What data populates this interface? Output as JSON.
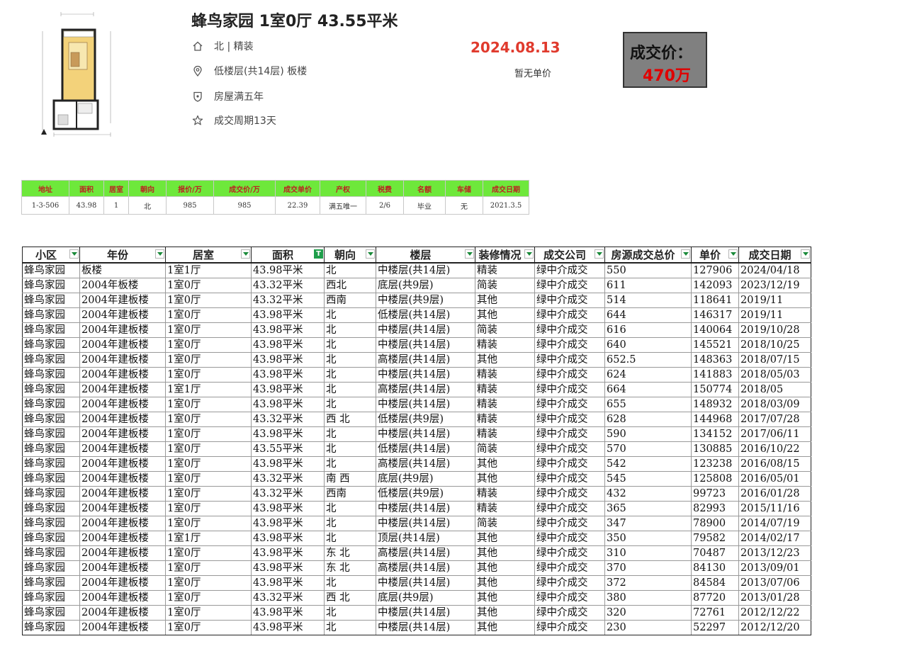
{
  "listing": {
    "title": "蜂鸟家园 1室0厅 43.55平米",
    "orientation_finish": "北 | 精装",
    "floor_building": "低楼层(共14层) 板楼",
    "ownership": "房屋满五年",
    "cycle": "成交周期13天",
    "deal_date": "2024.08.13",
    "unit_price_note": "暂无单价",
    "price_label": "成交价：",
    "price_value": "470万"
  },
  "icons": [
    "home-icon",
    "location-icon",
    "shield-icon",
    "star-icon"
  ],
  "colors": {
    "date_red": "#e03a2d",
    "price_red": "#e00000",
    "green_header": "#6ee83b",
    "filter_green": "#1e9e4a"
  },
  "summary_table": {
    "headers": [
      "地址",
      "面积",
      "居室",
      "朝向",
      "报价/万",
      "成交价/万",
      "成交单价",
      "产权",
      "税费",
      "名额",
      "车储",
      "成交日期"
    ],
    "row": [
      "1-3-506",
      "43.98",
      "1",
      "北",
      "985",
      "985",
      "22.39",
      "满五唯一",
      "2/6",
      "毕业",
      "无",
      "2021.3.5"
    ]
  },
  "deals_table": {
    "headers": [
      "小区",
      "年份",
      "居室",
      "面积",
      "朝向",
      "楼层",
      "装修情况",
      "成交公司",
      "房源成交总价",
      "单价",
      "成交日期"
    ],
    "filtered_column": "面积",
    "rows": [
      [
        "蜂鸟家园",
        "板楼",
        "1室1厅",
        "43.98平米",
        "北",
        "中楼层(共14层)",
        "精装",
        "绿中介成交",
        "550",
        "127906",
        "2024/04/18"
      ],
      [
        "蜂鸟家园",
        "2004年板楼",
        "1室0厅",
        "43.32平米",
        "西北",
        "底层(共9层)",
        "简装",
        "绿中介成交",
        "611",
        "142093",
        "2023/12/19"
      ],
      [
        "蜂鸟家园",
        "2004年建板楼",
        "1室0厅",
        "43.32平米",
        "西南",
        "中楼层(共9层)",
        "其他",
        "绿中介成交",
        "514",
        "118641",
        "2019/11"
      ],
      [
        "蜂鸟家园",
        "2004年建板楼",
        "1室0厅",
        "43.98平米",
        "北",
        "低楼层(共14层)",
        "其他",
        "绿中介成交",
        "644",
        "146317",
        "2019/11"
      ],
      [
        "蜂鸟家园",
        "2004年建板楼",
        "1室0厅",
        "43.98平米",
        "北",
        "中楼层(共14层)",
        "简装",
        "绿中介成交",
        "616",
        "140064",
        "2019/10/28"
      ],
      [
        "蜂鸟家园",
        "2004年建板楼",
        "1室0厅",
        "43.98平米",
        "北",
        "中楼层(共14层)",
        "精装",
        "绿中介成交",
        "640",
        "145521",
        "2018/10/25"
      ],
      [
        "蜂鸟家园",
        "2004年建板楼",
        "1室0厅",
        "43.98平米",
        "北",
        "高楼层(共14层)",
        "其他",
        "绿中介成交",
        "652.5",
        "148363",
        "2018/07/15"
      ],
      [
        "蜂鸟家园",
        "2004年建板楼",
        "1室0厅",
        "43.98平米",
        "北",
        "中楼层(共14层)",
        "精装",
        "绿中介成交",
        "624",
        "141883",
        "2018/05/03"
      ],
      [
        "蜂鸟家园",
        "2004年建板楼",
        "1室1厅",
        "43.98平米",
        "北",
        "高楼层(共14层)",
        "精装",
        "绿中介成交",
        "664",
        "150774",
        "2018/05"
      ],
      [
        "蜂鸟家园",
        "2004年建板楼",
        "1室0厅",
        "43.98平米",
        "北",
        "中楼层(共14层)",
        "精装",
        "绿中介成交",
        "655",
        "148932",
        "2018/03/09"
      ],
      [
        "蜂鸟家园",
        "2004年建板楼",
        "1室0厅",
        "43.32平米",
        "西 北",
        "低楼层(共9层)",
        "精装",
        "绿中介成交",
        "628",
        "144968",
        "2017/07/28"
      ],
      [
        "蜂鸟家园",
        "2004年建板楼",
        "1室0厅",
        "43.98平米",
        "北",
        "中楼层(共14层)",
        "精装",
        "绿中介成交",
        "590",
        "134152",
        "2017/06/11"
      ],
      [
        "蜂鸟家园",
        "2004年建板楼",
        "1室0厅",
        "43.55平米",
        "北",
        "低楼层(共14层)",
        "简装",
        "绿中介成交",
        "570",
        "130885",
        "2016/10/22"
      ],
      [
        "蜂鸟家园",
        "2004年建板楼",
        "1室0厅",
        "43.98平米",
        "北",
        "高楼层(共14层)",
        "其他",
        "绿中介成交",
        "542",
        "123238",
        "2016/08/15"
      ],
      [
        "蜂鸟家园",
        "2004年建板楼",
        "1室0厅",
        "43.32平米",
        "南 西",
        "底层(共9层)",
        "其他",
        "绿中介成交",
        "545",
        "125808",
        "2016/05/01"
      ],
      [
        "蜂鸟家园",
        "2004年建板楼",
        "1室0厅",
        "43.32平米",
        "西南",
        "低楼层(共9层)",
        "精装",
        "绿中介成交",
        "432",
        "99723",
        "2016/01/28"
      ],
      [
        "蜂鸟家园",
        "2004年建板楼",
        "1室0厅",
        "43.98平米",
        "北",
        "中楼层(共14层)",
        "精装",
        "绿中介成交",
        "365",
        "82993",
        "2015/11/16"
      ],
      [
        "蜂鸟家园",
        "2004年建板楼",
        "1室0厅",
        "43.98平米",
        "北",
        "中楼层(共14层)",
        "简装",
        "绿中介成交",
        "347",
        "78900",
        "2014/07/19"
      ],
      [
        "蜂鸟家园",
        "2004年建板楼",
        "1室1厅",
        "43.98平米",
        "北",
        "顶层(共14层)",
        "其他",
        "绿中介成交",
        "350",
        "79582",
        "2014/02/17"
      ],
      [
        "蜂鸟家园",
        "2004年建板楼",
        "1室0厅",
        "43.98平米",
        "东 北",
        "高楼层(共14层)",
        "其他",
        "绿中介成交",
        "310",
        "70487",
        "2013/12/23"
      ],
      [
        "蜂鸟家园",
        "2004年建板楼",
        "1室0厅",
        "43.98平米",
        "东 北",
        "高楼层(共14层)",
        "其他",
        "绿中介成交",
        "370",
        "84130",
        "2013/09/01"
      ],
      [
        "蜂鸟家园",
        "2004年建板楼",
        "1室0厅",
        "43.98平米",
        "北",
        "中楼层(共14层)",
        "其他",
        "绿中介成交",
        "372",
        "84584",
        "2013/07/06"
      ],
      [
        "蜂鸟家园",
        "2004年建板楼",
        "1室0厅",
        "43.32平米",
        "西 北",
        "底层(共9层)",
        "其他",
        "绿中介成交",
        "380",
        "87720",
        "2013/01/28"
      ],
      [
        "蜂鸟家园",
        "2004年建板楼",
        "1室0厅",
        "43.98平米",
        "北",
        "中楼层(共14层)",
        "其他",
        "绿中介成交",
        "320",
        "72761",
        "2012/12/22"
      ],
      [
        "蜂鸟家园",
        "2004年建板楼",
        "1室0厅",
        "43.98平米",
        "北",
        "中楼层(共14层)",
        "其他",
        "绿中介成交",
        "230",
        "52297",
        "2012/12/20"
      ]
    ]
  }
}
